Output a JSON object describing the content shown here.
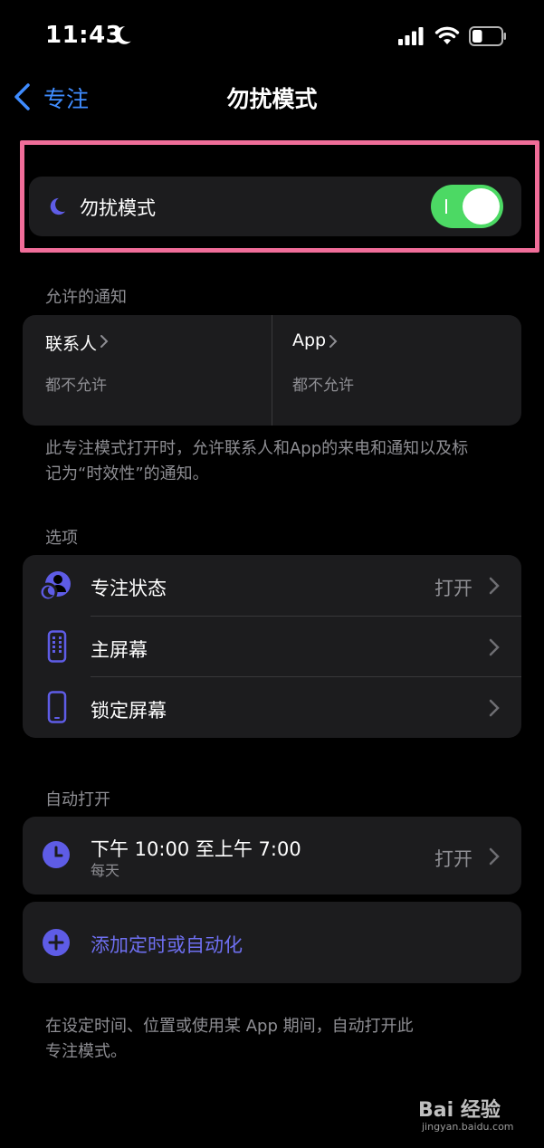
{
  "status_bar": {
    "time": "11:43",
    "battery_level": 0.35
  },
  "nav": {
    "back_label": "专注",
    "title": "勿扰模式"
  },
  "toggle": {
    "label": "勿扰模式",
    "on": true,
    "color": "#4cd964"
  },
  "allowed": {
    "header": "允许的通知",
    "people": {
      "title": "联系人",
      "subtitle": "都不允许"
    },
    "apps": {
      "title": "App",
      "subtitle": "都不允许"
    },
    "footnote_line1": "此专注模式打开时，允许联系人和App的来电和通知以及标",
    "footnote_line2": "记为“时效性”的通知。"
  },
  "options": {
    "header": "选项",
    "items": [
      {
        "label": "专注状态",
        "value": "打开",
        "icon": "focus-status-icon"
      },
      {
        "label": "主屏幕",
        "value": "",
        "icon": "home-screen-icon"
      },
      {
        "label": "锁定屏幕",
        "value": "",
        "icon": "lock-screen-icon"
      }
    ]
  },
  "auto": {
    "header": "自动打开",
    "schedule": {
      "time": "下午 10:00 至上午 7:00",
      "repeat": "每天",
      "value": "打开"
    },
    "add_label": "添加定时或自动化",
    "footnote_line1": "在设定时间、位置或使用某 App 期间，自动打开此",
    "footnote_line2": "专注模式。"
  },
  "colors": {
    "accent_blue": "#3f8cff",
    "accent_purple": "#5e5ce6",
    "highlight": "#f06d99"
  },
  "watermark": {
    "main": "Bai 经验",
    "sub": "jingyan.baidu.com"
  }
}
